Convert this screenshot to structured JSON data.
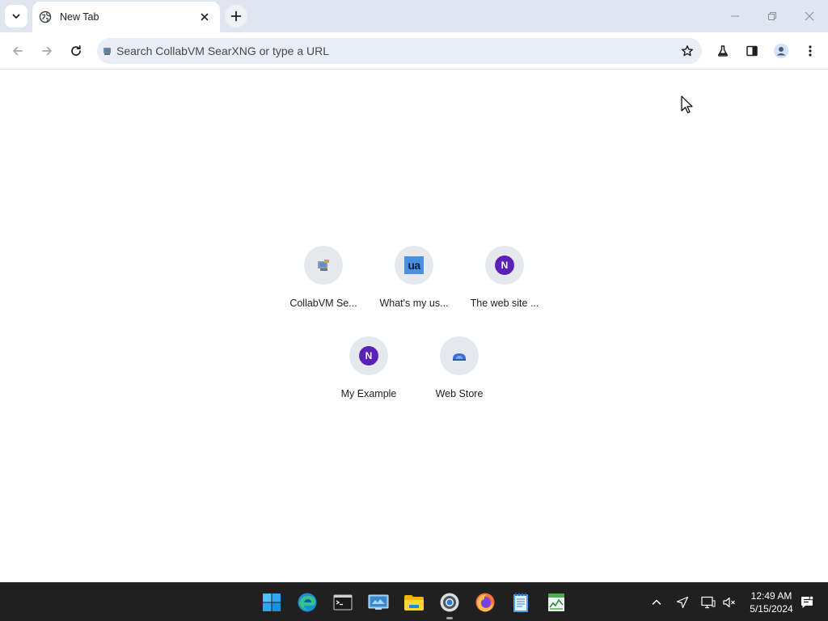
{
  "browser": {
    "tab": {
      "title": "New Tab"
    },
    "omnibox": {
      "placeholder": "Search CollabVM SearXNG or type a URL",
      "value": ""
    }
  },
  "shortcuts": [
    {
      "label": "CollabVM Se...",
      "icon": "collabvm-icon"
    },
    {
      "label": "What's my us...",
      "icon": "ua-icon",
      "badge_text": "ua"
    },
    {
      "label": "The web site ...",
      "icon": "n-icon",
      "badge_text": "N"
    },
    {
      "label": "My Example",
      "icon": "n-icon",
      "badge_text": "N"
    },
    {
      "label": "Web Store",
      "icon": "web-store-icon"
    }
  ],
  "taskbar": {
    "apps": [
      "start-icon",
      "edge-icon",
      "terminal-icon",
      "control-panel-icon",
      "file-explorer-icon",
      "chrome-icon",
      "firefox-icon",
      "notepad-icon",
      "task-manager-icon"
    ],
    "clock": {
      "time": "12:49 AM",
      "date": "5/15/2024"
    }
  },
  "colors": {
    "tabstrip": "#dfe6ef",
    "omnibox": "#e9eef6",
    "taskbar": "#202020",
    "n_badge": "#5b21b6",
    "ua_badge": "#4a90e2"
  }
}
